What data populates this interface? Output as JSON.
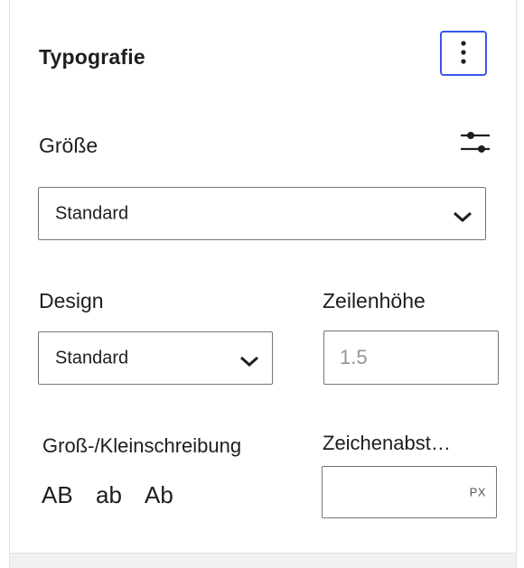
{
  "panel": {
    "title": "Typografie",
    "options_icon": "vertical-ellipsis-icon"
  },
  "size": {
    "label": "Größe",
    "settings_icon": "sliders-icon",
    "select_value": "Standard"
  },
  "design": {
    "label": "Design",
    "select_value": "Standard"
  },
  "line_height": {
    "label": "Zeilenhöhe",
    "placeholder": "1.5"
  },
  "letter_case": {
    "label": "Groß-/Kleinschreibung",
    "options": [
      "AB",
      "ab",
      "Ab"
    ]
  },
  "letter_spacing": {
    "label": "Zeichenabst…",
    "value": "",
    "unit": "PX"
  },
  "colors": {
    "focus_accent": "#3858e9",
    "border": "#757575",
    "text": "#1e1e1e"
  }
}
